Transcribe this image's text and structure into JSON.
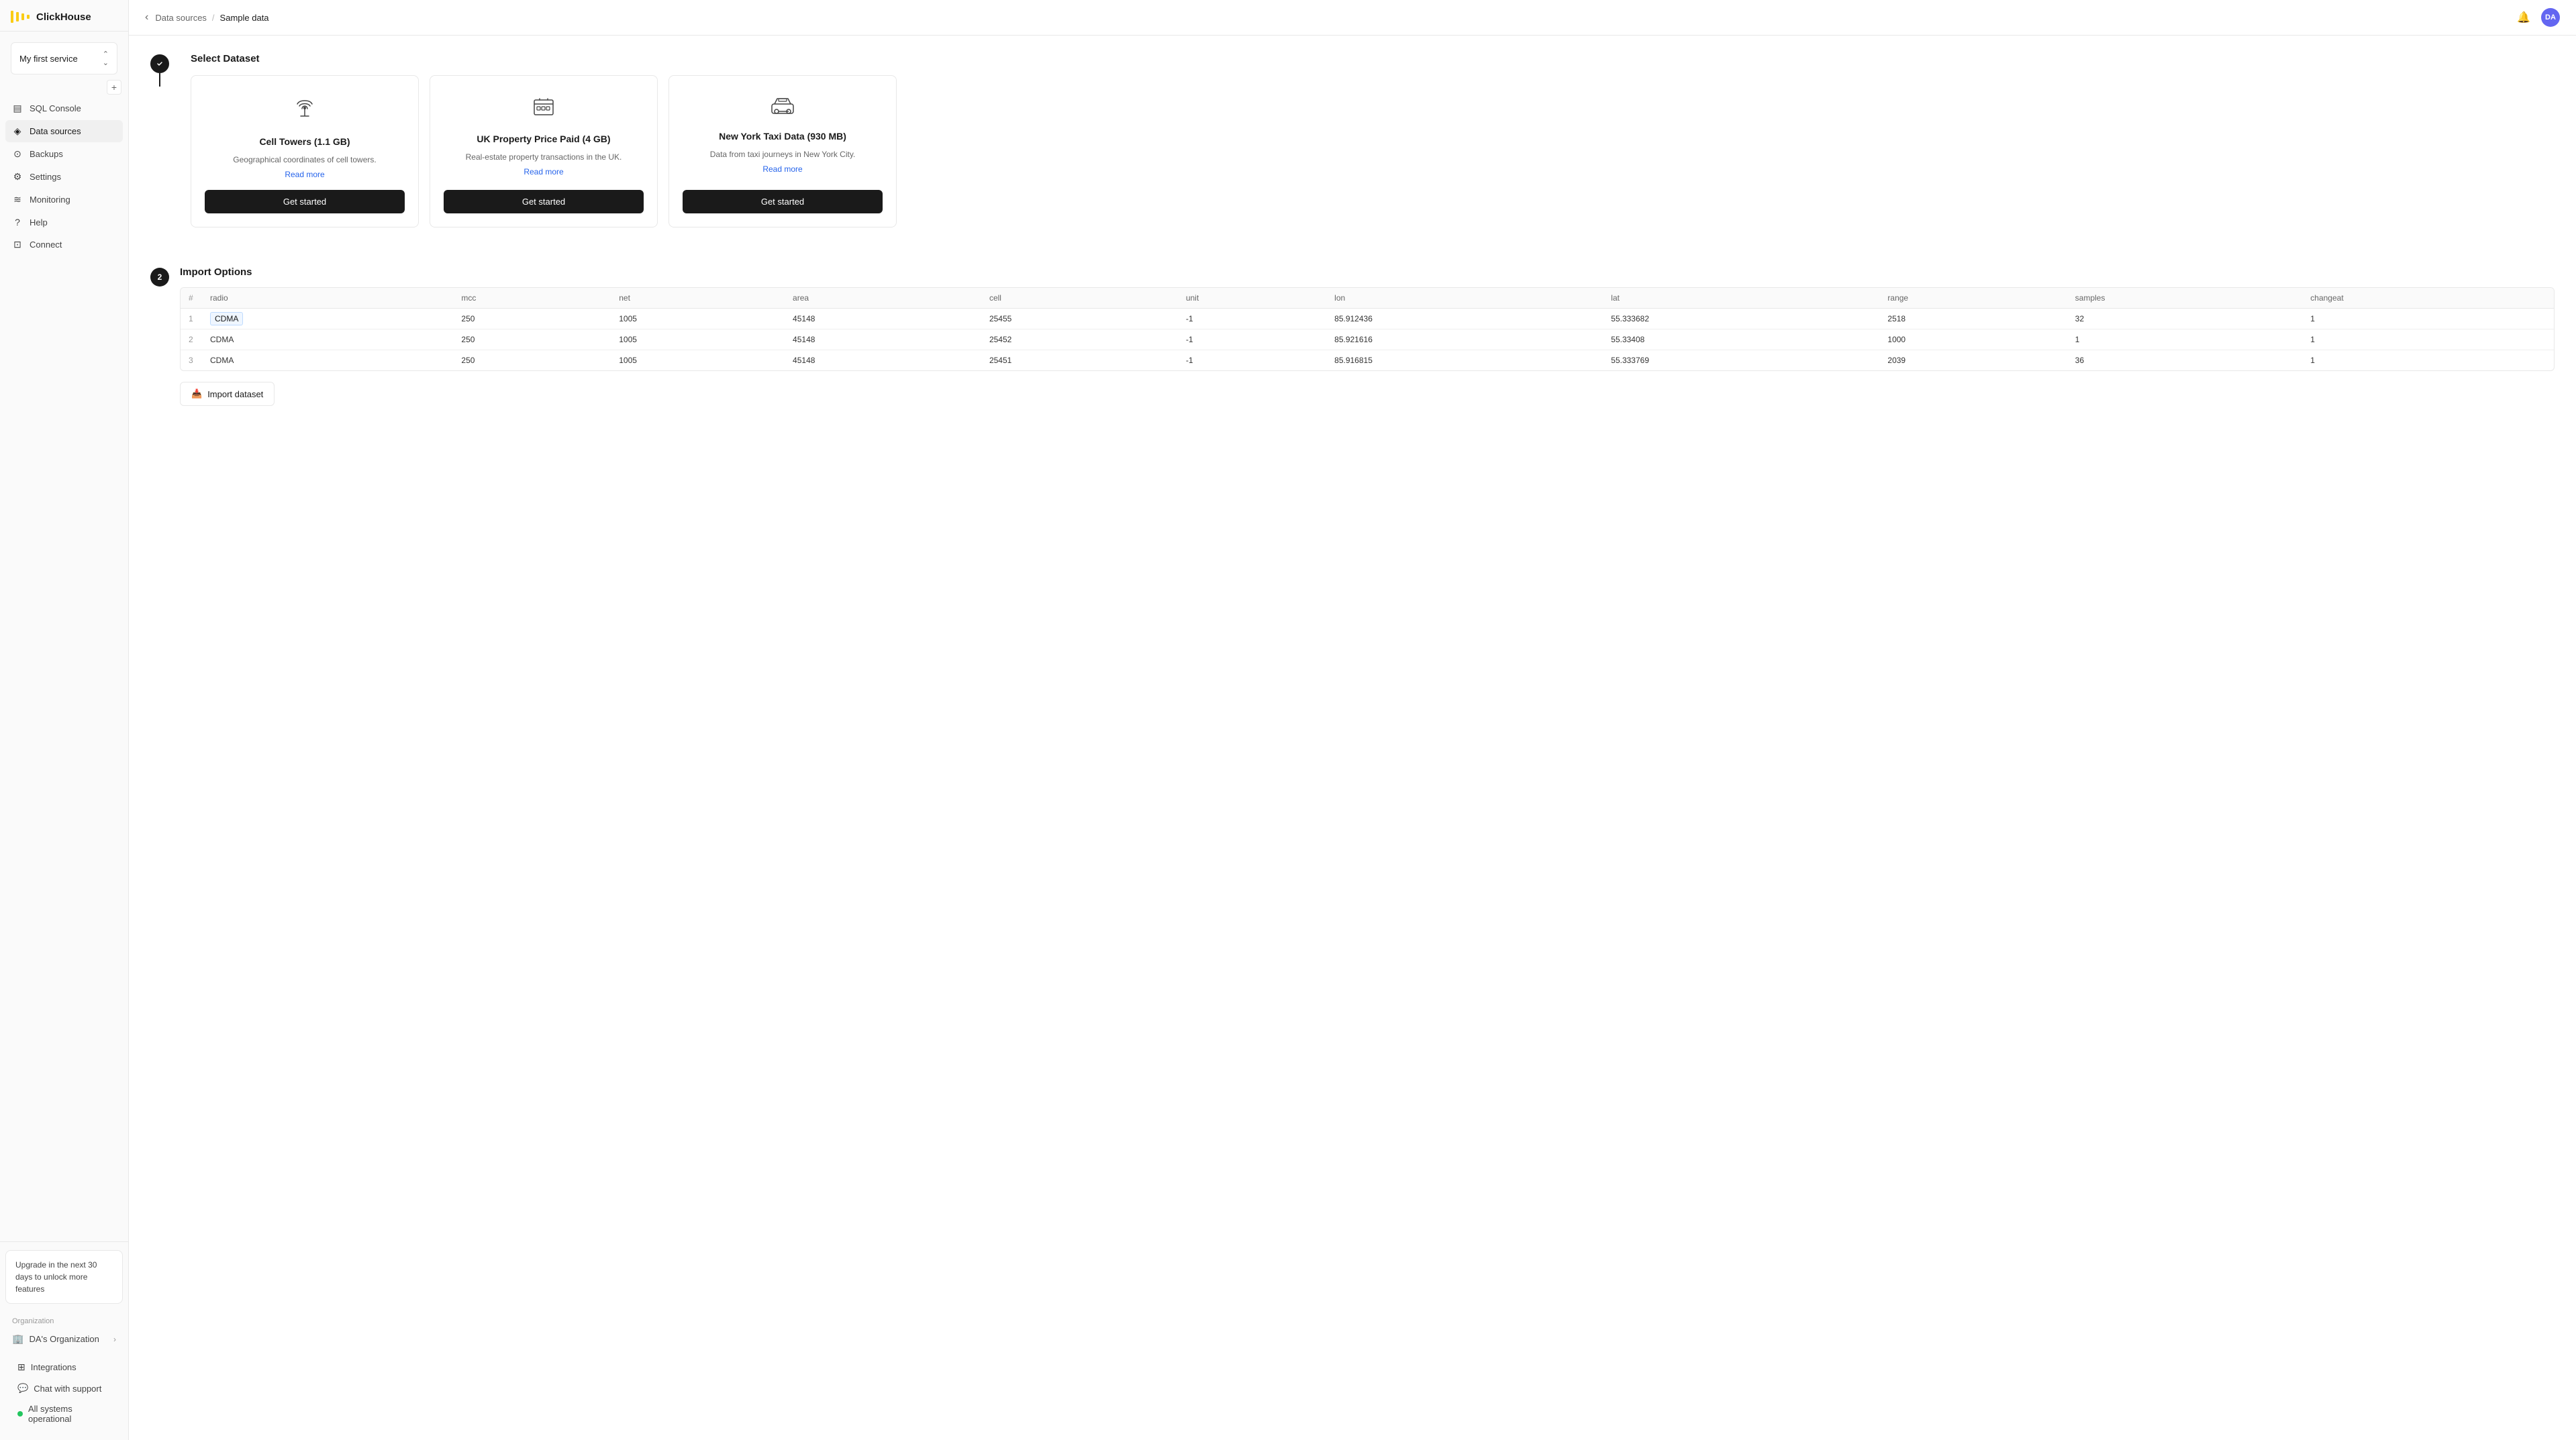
{
  "app": {
    "name": "ClickHouse"
  },
  "sidebar": {
    "service_name": "My first service",
    "nav_items": [
      {
        "id": "sql-console",
        "label": "SQL Console",
        "icon": "⊞"
      },
      {
        "id": "data-sources",
        "label": "Data sources",
        "icon": "◈",
        "active": true
      },
      {
        "id": "backups",
        "label": "Backups",
        "icon": "⊙"
      },
      {
        "id": "settings",
        "label": "Settings",
        "icon": "⊟"
      },
      {
        "id": "monitoring",
        "label": "Monitoring",
        "icon": "≋"
      },
      {
        "id": "help",
        "label": "Help",
        "icon": "?"
      },
      {
        "id": "connect",
        "label": "Connect",
        "icon": "⊡"
      }
    ],
    "upgrade_text": "Upgrade in the next 30 days to unlock more features",
    "org_label": "Organization",
    "org_name": "DA's Organization",
    "bottom_links": [
      {
        "id": "integrations",
        "label": "Integrations",
        "icon": "⊞"
      },
      {
        "id": "chat-support",
        "label": "Chat with support",
        "icon": "💬"
      },
      {
        "id": "status",
        "label": "All systems operational",
        "icon": "dot"
      }
    ]
  },
  "breadcrumb": {
    "back": "‹",
    "parent": "Data sources",
    "separator": "/",
    "current": "Sample data"
  },
  "step1": {
    "title": "Select Dataset",
    "cards": [
      {
        "id": "cell-towers",
        "title": "Cell Towers (1.1 GB)",
        "desc": "Geographical coordinates of cell towers.",
        "link": "Read more",
        "button": "Get started"
      },
      {
        "id": "uk-property",
        "title": "UK Property Price Paid (4 GB)",
        "desc": "Real-estate property transactions in the UK.",
        "link": "Read more",
        "button": "Get started"
      },
      {
        "id": "ny-taxi",
        "title": "New York Taxi Data (930 MB)",
        "desc": "Data from taxi journeys in New York City.",
        "link": "Read more",
        "button": "Get started"
      }
    ]
  },
  "step2": {
    "number": "2",
    "title": "Import Options",
    "table": {
      "columns": [
        "#",
        "radio",
        "mcc",
        "net",
        "area",
        "cell",
        "unit",
        "lon",
        "lat",
        "range",
        "samples",
        "changeat"
      ],
      "rows": [
        {
          "num": "1",
          "radio": "CDMA",
          "mcc": "250",
          "net": "1005",
          "area": "45148",
          "cell": "25455",
          "unit": "-1",
          "lon": "85.912436",
          "lat": "55.333682",
          "range": "2518",
          "samples": "32",
          "changeat": "1"
        },
        {
          "num": "2",
          "radio": "CDMA",
          "mcc": "250",
          "net": "1005",
          "area": "45148",
          "cell": "25452",
          "unit": "-1",
          "lon": "85.921616",
          "lat": "55.33408",
          "range": "1000",
          "samples": "1",
          "changeat": "1"
        },
        {
          "num": "3",
          "radio": "CDMA",
          "mcc": "250",
          "net": "1005",
          "area": "45148",
          "cell": "25451",
          "unit": "-1",
          "lon": "85.916815",
          "lat": "55.333769",
          "range": "2039",
          "samples": "36",
          "changeat": "1"
        }
      ]
    },
    "import_button": "Import dataset"
  },
  "user": {
    "initials": "DA"
  }
}
